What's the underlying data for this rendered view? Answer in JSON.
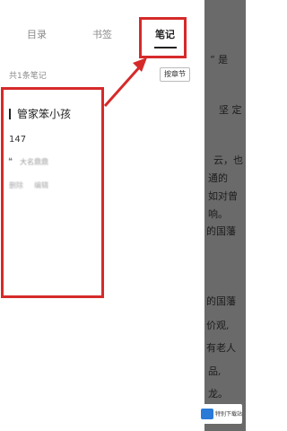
{
  "drawer": {
    "tabs": [
      {
        "label": "目录"
      },
      {
        "label": "书签"
      },
      {
        "label": "笔记"
      }
    ],
    "note_count": "共1条笔记",
    "by_chapter_label": "按章节",
    "note": {
      "chapter_title": "管家笨小孩",
      "number": "147",
      "quote_icon": "❝",
      "quote_text": "大名鼎鼎",
      "delete_label": "删除",
      "edit_label": "编辑"
    }
  },
  "reader_lines": [
    {
      "text": "“ 是"
    },
    {
      "text": "坚 定"
    },
    {
      "text": "云，也"
    },
    {
      "text": "通的"
    },
    {
      "text": "如对曾"
    },
    {
      "text": "响。"
    },
    {
      "text": "的国藩"
    },
    {
      "text": "的国藩"
    },
    {
      "text": "价观,"
    },
    {
      "text": "有老人"
    },
    {
      "text": "品,"
    },
    {
      "text": "龙。"
    }
  ],
  "watermark": {
    "text": "特别下载站"
  },
  "colors": {
    "annotation_red": "#d62a2a",
    "dim_background": "#6a6a6a"
  }
}
